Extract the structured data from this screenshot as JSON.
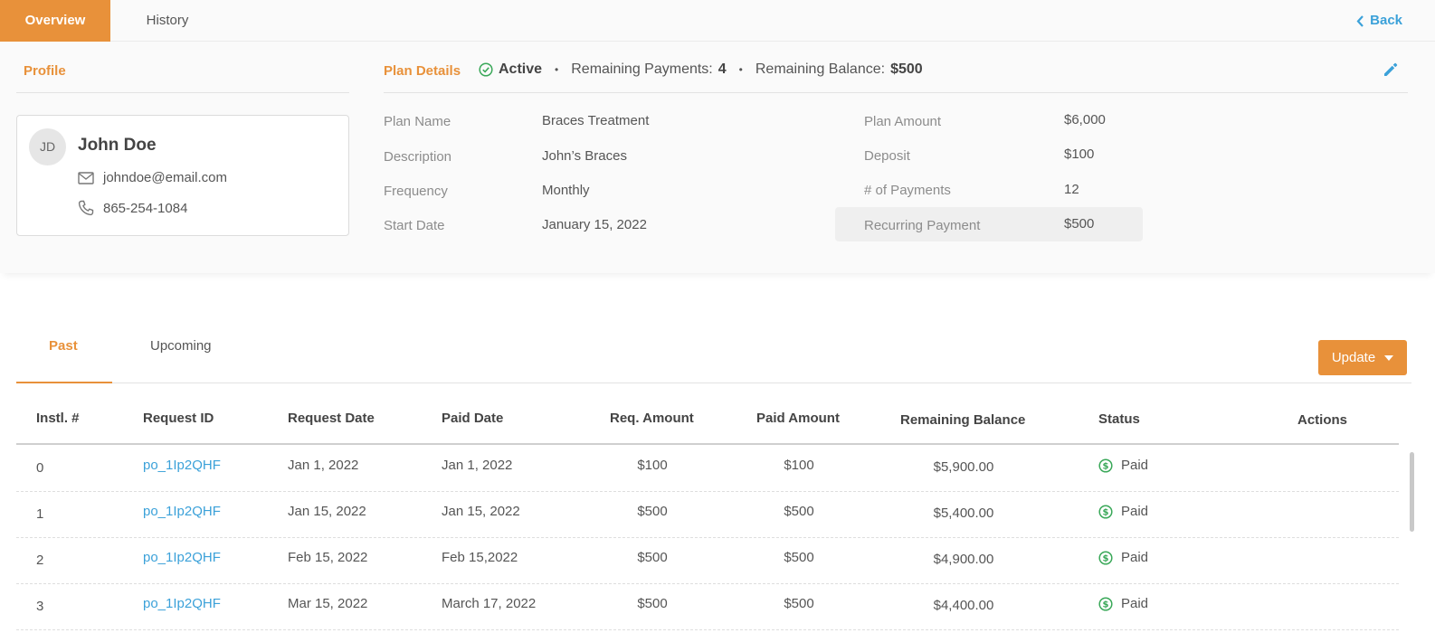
{
  "tabs": {
    "overview": "Overview",
    "history": "History",
    "back": "Back"
  },
  "profile": {
    "title": "Profile",
    "initials": "JD",
    "name": "John Doe",
    "email": "johndoe@email.com",
    "phone": "865-254-1084"
  },
  "plan": {
    "title": "Plan Details",
    "status": "Active",
    "remaining_payments_label": "Remaining Payments:",
    "remaining_payments": "4",
    "remaining_balance_label": "Remaining Balance:",
    "remaining_balance": "$500",
    "fields_left": [
      {
        "label": "Plan Name",
        "value": "Braces Treatment"
      },
      {
        "label": "Description",
        "value": "John’s Braces"
      },
      {
        "label": "Frequency",
        "value": "Monthly"
      },
      {
        "label": "Start Date",
        "value": "January 15, 2022"
      }
    ],
    "fields_right": [
      {
        "label": "Plan Amount",
        "value": "$6,000"
      },
      {
        "label": "Deposit",
        "value": "$100"
      },
      {
        "label": "# of Payments",
        "value": "12"
      },
      {
        "label": "Recurring Payment",
        "value": "$500"
      }
    ]
  },
  "payments": {
    "tabs": {
      "past": "Past",
      "upcoming": "Upcoming"
    },
    "update_label": "Update",
    "columns": [
      "Instl. #",
      "Request ID",
      "Request Date",
      "Paid Date",
      "Req. Amount",
      "Paid Amount",
      "Remaining Balance",
      "Status",
      "Actions"
    ],
    "rows": [
      {
        "instl": "0",
        "request_id": "po_1Ip2QHF",
        "request_date": "Jan 1, 2022",
        "paid_date": "Jan 1, 2022",
        "req_amount": "$100",
        "paid_amount": "$100",
        "remaining": "$5,900.00",
        "status": "Paid"
      },
      {
        "instl": "1",
        "request_id": "po_1Ip2QHF",
        "request_date": "Jan 15, 2022",
        "paid_date": "Jan 15, 2022",
        "req_amount": "$500",
        "paid_amount": "$500",
        "remaining": "$5,400.00",
        "status": "Paid"
      },
      {
        "instl": "2",
        "request_id": "po_1Ip2QHF",
        "request_date": "Feb 15, 2022",
        "paid_date": "Feb 15,2022",
        "req_amount": "$500",
        "paid_amount": "$500",
        "remaining": "$4,900.00",
        "status": "Paid"
      },
      {
        "instl": "3",
        "request_id": "po_1Ip2QHF",
        "request_date": "Mar 15, 2022",
        "paid_date": "March 17, 2022",
        "req_amount": "$500",
        "paid_amount": "$500",
        "remaining": "$4,400.00",
        "status": "Paid"
      }
    ]
  },
  "colors": {
    "accent": "#e8913a",
    "link": "#3ba1d9",
    "success": "#3aa859"
  }
}
